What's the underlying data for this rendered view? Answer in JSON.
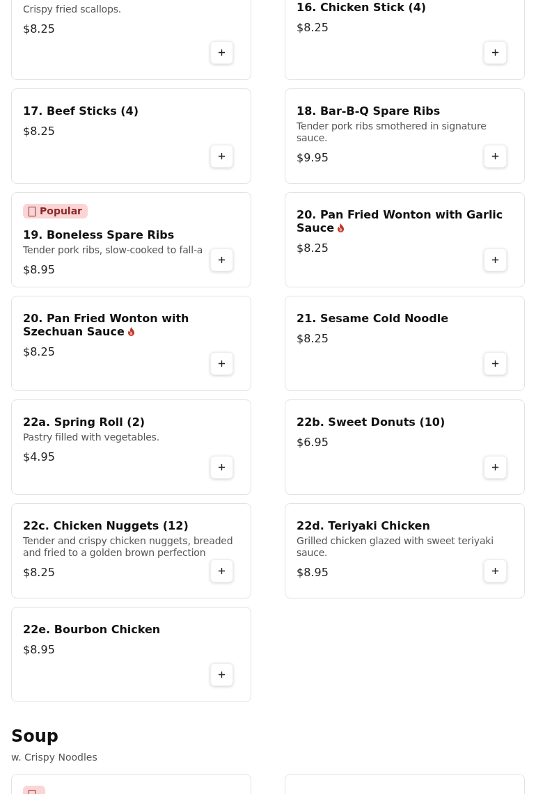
{
  "sections": [
    {
      "items": [
        {
          "description": "Crispy fried scallops.",
          "price": "$8.25",
          "popular": false,
          "spicy": false
        },
        {
          "name": "16. Chicken Stick (4)",
          "price": "$8.25",
          "popular": false,
          "spicy": false
        },
        {
          "name": "17. Beef Sticks (4)",
          "price": "$8.25",
          "popular": false,
          "spicy": false
        },
        {
          "name": "18. Bar-B-Q Spare Ribs",
          "description": "Tender pork ribs smothered in signature sauce.",
          "price": "$9.95",
          "popular": false,
          "spicy": false
        },
        {
          "badge": "Popular",
          "name": "19. Boneless Spare Ribs",
          "description": "Tender pork ribs, slow-cooked to fall-a",
          "price": "$8.95",
          "popular": true,
          "spicy": false
        },
        {
          "name": "20. Pan Fried Wonton with Garlic Sauce",
          "price": "$8.25",
          "popular": false,
          "spicy": true
        },
        {
          "name": "20. Pan Fried Wonton with Szechuan Sauce",
          "price": "$8.25",
          "popular": false,
          "spicy": true
        },
        {
          "name": "21. Sesame Cold Noodle",
          "price": "$8.25",
          "popular": false,
          "spicy": false
        },
        {
          "name": "22a. Spring Roll (2)",
          "description": "Pastry filled with vegetables.",
          "price": "$4.95",
          "popular": false,
          "spicy": false
        },
        {
          "name": "22b. Sweet Donuts (10)",
          "price": "$6.95",
          "popular": false,
          "spicy": false
        },
        {
          "name": "22c. Chicken Nuggets (12)",
          "description": "Tender and crispy chicken nuggets, breaded and fried to a golden brown perfection",
          "price": "$8.25",
          "popular": false,
          "spicy": false
        },
        {
          "name": "22d. Teriyaki Chicken",
          "description": "Grilled chicken glazed with sweet teriyaki sauce.",
          "price": "$8.95",
          "popular": false,
          "spicy": false
        },
        {
          "name": "22e. Bourbon Chicken",
          "price": "$8.95",
          "popular": false,
          "spicy": false
        }
      ]
    },
    {
      "title": "Soup",
      "subtitle": "w. Crispy Noodles",
      "items": [
        {
          "popular": true,
          "spicy": false
        },
        {
          "popular": false,
          "spicy": false
        }
      ]
    }
  ]
}
